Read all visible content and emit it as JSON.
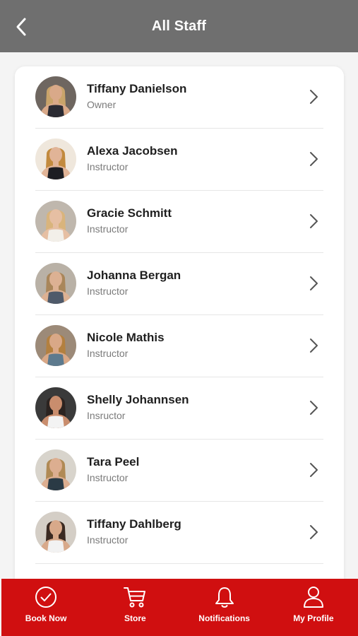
{
  "header": {
    "title": "All Staff"
  },
  "staff": [
    {
      "name": "Tiffany Danielson",
      "role": "Owner",
      "skin": "#d9a989",
      "hair": "#c9a46a",
      "shirt": "#2b2b33",
      "bg": "#6e6660"
    },
    {
      "name": "Alexa Jacobsen",
      "role": "Instructor",
      "skin": "#e1b497",
      "hair": "#c28a3e",
      "shirt": "#1d1d22",
      "bg": "#efe7dc"
    },
    {
      "name": "Gracie Schmitt",
      "role": "Instructor",
      "skin": "#e6bfa3",
      "hair": "#d9b47c",
      "shirt": "#f2efe9",
      "bg": "#bfb7ad"
    },
    {
      "name": "Johanna Bergan",
      "role": "Instructor",
      "skin": "#dcb193",
      "hair": "#a9865a",
      "shirt": "#4f5a6a",
      "bg": "#b9b1a6"
    },
    {
      "name": "Nicole Mathis",
      "role": "Instructor",
      "skin": "#d9a887",
      "hair": "#b3803f",
      "shirt": "#5d7a8e",
      "bg": "#9c8a78"
    },
    {
      "name": "Shelly Johannsen",
      "role": "Insructor",
      "skin": "#c98d6d",
      "hair": "#2b2320",
      "shirt": "#f3f3f3",
      "bg": "#3a3a3a"
    },
    {
      "name": "Tara Peel",
      "role": "Instructor",
      "skin": "#dcae90",
      "hair": "#b08a55",
      "shirt": "#2a3a45",
      "bg": "#d8d4cc"
    },
    {
      "name": "Tiffany Dahlberg",
      "role": "Instructor",
      "skin": "#d8a98a",
      "hair": "#3b2a22",
      "shirt": "#f2f2f2",
      "bg": "#d4cec6"
    }
  ],
  "tabbar": {
    "items": [
      {
        "label": "Book Now",
        "icon": "check-circle-icon"
      },
      {
        "label": "Store",
        "icon": "cart-icon"
      },
      {
        "label": "Notifications",
        "icon": "bell-icon"
      },
      {
        "label": "My Profile",
        "icon": "user-icon"
      }
    ]
  },
  "colors": {
    "header": "#6f6f6f",
    "tabbar": "#d00f10",
    "accent_text": "#ffffff"
  }
}
